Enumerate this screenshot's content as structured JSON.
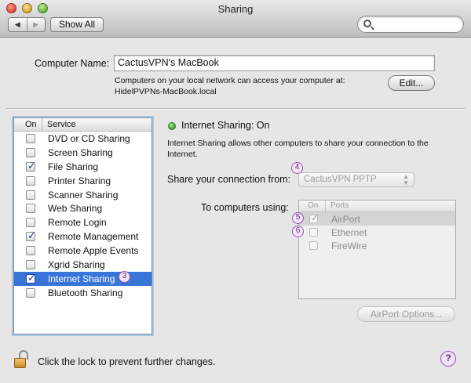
{
  "window": {
    "title": "Sharing"
  },
  "toolbar": {
    "back_label": "◀",
    "forward_label": "▶",
    "show_all_label": "Show All",
    "search_placeholder": ""
  },
  "computer_name": {
    "label": "Computer Name:",
    "value": "CactusVPN's MacBook",
    "note_line1": "Computers on your local network can access your computer at:",
    "note_line2": "HidelPVPNs-MacBook.local",
    "edit_label": "Edit..."
  },
  "services": {
    "header_on": "On",
    "header_service": "Service",
    "items": [
      {
        "label": "DVD or CD Sharing",
        "checked": false
      },
      {
        "label": "Screen Sharing",
        "checked": false
      },
      {
        "label": "File Sharing",
        "checked": true
      },
      {
        "label": "Printer Sharing",
        "checked": false
      },
      {
        "label": "Scanner Sharing",
        "checked": false
      },
      {
        "label": "Web Sharing",
        "checked": false
      },
      {
        "label": "Remote Login",
        "checked": false
      },
      {
        "label": "Remote Management",
        "checked": true
      },
      {
        "label": "Remote Apple Events",
        "checked": false
      },
      {
        "label": "Xgrid Sharing",
        "checked": false
      },
      {
        "label": "Internet Sharing",
        "checked": true,
        "selected": true
      },
      {
        "label": "Bluetooth Sharing",
        "checked": false
      }
    ]
  },
  "detail": {
    "status": "Internet Sharing: On",
    "status_color": "#3aa02a",
    "description": "Internet Sharing allows other computers to share your connection to the Internet.",
    "share_from_label": "Share your connection from:",
    "share_from_value": "CactusVPN PPTP",
    "to_computers_label": "To computers using:",
    "ports_header_on": "On",
    "ports_header_ports": "Ports",
    "ports": [
      {
        "label": "AirPort",
        "checked": true
      },
      {
        "label": "Ethernet",
        "checked": false
      },
      {
        "label": "FireWire",
        "checked": false
      }
    ],
    "airport_options_label": "AirPort Options..."
  },
  "annotations": {
    "b3": "3",
    "b4": "4",
    "b5": "5",
    "b6": "6"
  },
  "footer": {
    "lock_text": "Click the lock to prevent further changes.",
    "help_label": "?"
  },
  "colors": {
    "selection": "#3875d7",
    "annotation": "#9b4fb5"
  },
  "icons": [
    "search-icon",
    "lock-icon",
    "help-icon"
  ]
}
